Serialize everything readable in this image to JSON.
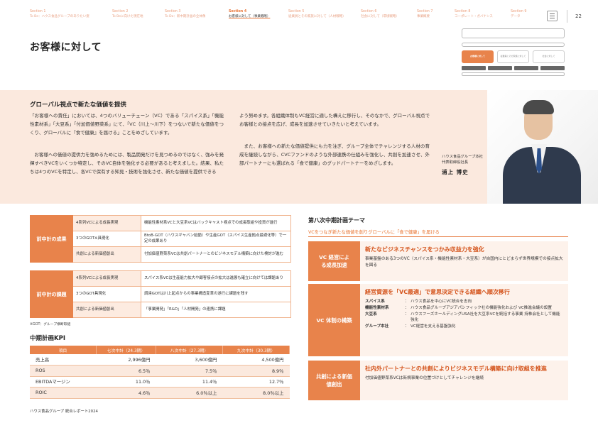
{
  "nav": {
    "items": [
      {
        "section": "Section 1",
        "sub": "To Be：ハウス食品グループのありたい姿"
      },
      {
        "section": "Section 2",
        "sub": "To Beに向けた現在地"
      },
      {
        "section": "Section 3",
        "sub": "To Do：新中期計画の全体像"
      },
      {
        "section": "Section 4",
        "sub": "お客様に対して（事業戦略）"
      },
      {
        "section": "Section 5",
        "sub": "従業員とその家族に対して（人材戦略）"
      },
      {
        "section": "Section 6",
        "sub": "社会に対して（環境戦略）"
      },
      {
        "section": "Section 7",
        "sub": "事業概要"
      },
      {
        "section": "Section 8",
        "sub": "コーポレート・ガバナンス"
      },
      {
        "section": "Section 9",
        "sub": "データ"
      }
    ],
    "page_number": "22"
  },
  "page_title": "お客様に対して",
  "mini_diagram": {
    "boxes": [
      "お客様に対して",
      "従業員とその家族に対して",
      "社会に対して"
    ]
  },
  "message": {
    "title": "グローバル視点で新たな価値を提供",
    "para1": "「お客様への責任」においては、4つのバリューチェーン（VC）である「スパイス系」「機能性素材系」「大豆系」「付加価値野菜系」にて、「VC（川上～川下）をつないで新たな価値をつくり、グローバルに『食で健康』を届ける」ことをめざしています。",
    "para2": "お客様への価値の提供力を強めるためには、製品開発だけを見つめるのではなく、強みを発揮すべきVCをいくつか特定し、そのVC自体を強化する必要があると考えました。結果、私たちは4つのVCを特定し、各VCで保有する知見・技術を強化させ、新たな価値を提供できる",
    "para3": "よう努めます。各組織体制もVC経営に適した構えに移行し、そのなかで、グローバル視点でお客様との接点を広げ、成長を加速させていきたいと考えています。",
    "para4": "また、お客様への新たな価値提供にも力を注ぎ、グループ全体でチャレンジする人材の育成を継続しながら、CVCファンドのような外部連携の仕組みを強化し、共創を加速させ、外部パートナーにも選ばれる「食で健康」のグッドパートナーをめざします。",
    "role1": "ハウス食品グループ本社",
    "role2": "代表取締役社長",
    "name": "浦上 博史"
  },
  "results": {
    "header": "前中計の成果",
    "rows": [
      {
        "label": "4系列VCによる成長実現",
        "text": "機能性素材系VCと大豆系VCはバックキャスト視点での成長取組や投資が進行"
      },
      {
        "label": "3つのGOT※具現化",
        "text": "BtoB-GOT（ハウスギャバン始動）や生産GOT（スパイス生産拠点最適化等）で一定の成果あり"
      },
      {
        "label": "共創による新価値創出",
        "text": "付加価値野菜系VCは共創パートナーとのビジネスモデル構築に向けた検討が進む"
      }
    ]
  },
  "issues": {
    "header": "前中計の課題",
    "rows": [
      {
        "label": "4系列VCによる成長実現",
        "text": "スパイス系VCは生産能力拡大や顧客接点の拡大は進展も確立に向けては課題あり"
      },
      {
        "label": "3つのGOT具現化",
        "text": "調達GOTは川上起点からの事業構造変革の遂行に課題を残す"
      },
      {
        "label": "共創による新価値創出",
        "text": "「事業開発」「R&D」「人材開発」の連携に課題"
      }
    ]
  },
  "note": "※GOT：グループ横断取組",
  "kpi": {
    "title": "中期計画KPI",
    "headers": [
      "項目",
      "七次中計（24.3期）",
      "八次中計（27.3期）",
      "九次中計（30.3期）"
    ],
    "rows": [
      {
        "item": "売上高",
        "v1": "2,996億円",
        "v2": "3,600億円",
        "v3": "4,500億円"
      },
      {
        "item": "ROS",
        "v1": "6.5％",
        "v2": "7.5％",
        "v3": "8.9％"
      },
      {
        "item": "EBITDAマージン",
        "v1": "11.0％",
        "v2": "11.4％",
        "v3": "12.7％"
      },
      {
        "item": "ROIC",
        "v1": "4.6％",
        "v2": "6.0％以上",
        "v3": "8.0％以上"
      }
    ]
  },
  "plan": {
    "title": "第八次中期計画テーマ",
    "subtitle": "VCをつなぎ新たな価値を創りグローバルに「食で健康」を届ける",
    "blocks": [
      {
        "header": "VC 経営による成長加速",
        "heading": "新たなビジネスチャンスをつかみ収益力を強化",
        "text": "事業基盤のある3つのVC（スパイス系・機能性素材系・大豆系）が自国内にとどまらず世界規模での接点拡大を図る"
      },
      {
        "header": "VC 体制の構築",
        "heading": "経営資源を「VC最適」で意思決定できる組織へ順次移行",
        "defs": [
          {
            "k": "スパイス系",
            "v": "ハウス食品を中心にVC統合を志向"
          },
          {
            "k": "機能性素材系",
            "v": "ハウス食品グループアジアパシフィック社の機能強化および VC推進会議の設置"
          },
          {
            "k": "大豆系",
            "v": "ハウスフーズホールディングUSA社を大豆系VCを統括する事業 持株会社として機能強化"
          },
          {
            "k": "グループ本社",
            "v": "VC経営を支える基盤強化"
          }
        ]
      },
      {
        "header": "共創による新価値創出",
        "heading": "社内外パートナーとの共創によりビジネスモデル構築に向け取組を推進",
        "text": "付加価値野菜系VCは新規事業の位置づけとしてチャレンジを継続"
      }
    ]
  },
  "footer": "ハウス食品グループ 統合レポート2024",
  "colors": {
    "accent": "#e8834b",
    "accent_dark": "#d4541c",
    "band": "#fbe9de"
  }
}
